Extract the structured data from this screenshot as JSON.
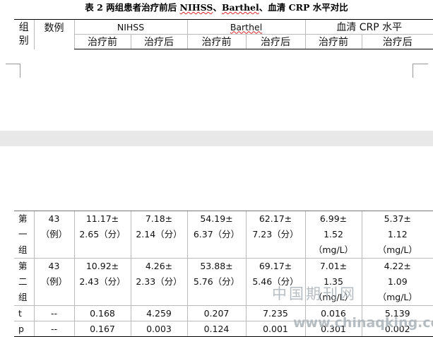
{
  "title": {
    "prefix": "表 2 两组患者治疗前后 ",
    "nihss": "NIHSS",
    "sep1": "、",
    "barthel": "Barthel",
    "suffix": "、血清 CRP 水平对比"
  },
  "header": {
    "group_col": "组\n别",
    "count_col": "数例",
    "nihss": "NIHSS",
    "barthel": "Barthel",
    "crp": "血清 CRP 水平",
    "before": "治疗前",
    "after": "治疗后"
  },
  "rows": [
    {
      "group": "第\n一\n组",
      "count": "43\n（例）",
      "nihss_before": "11.17±\n2.65（分）",
      "nihss_after": "7.18±\n2.14（分）",
      "barthel_before": "54.19±\n6.37（分）",
      "barthel_after": "62.17±\n7.23（分）",
      "crp_before": "6.99±\n1.52\n（mg/L）",
      "crp_after": "5.37±\n1.12\n（mg/L）"
    },
    {
      "group": "第\n二\n组",
      "count": "43\n（例）",
      "nihss_before": "10.92±\n2.43（分）",
      "nihss_after": "4.26±\n2.33（分）",
      "barthel_before": "53.88±\n5.76（分）",
      "barthel_after": "69.17±\n5.46（分）",
      "crp_before": "7.01±\n1.35\n（mg/L）",
      "crp_after": "4.22±\n1.09\n（mg/L）"
    },
    {
      "group": "t",
      "count": "--",
      "nihss_before": "0.168",
      "nihss_after": "4.259",
      "barthel_before": "0.207",
      "barthel_after": "7.235",
      "crp_before": "0.016",
      "crp_after": "5.139"
    },
    {
      "group": "p",
      "count": "--",
      "nihss_before": "0.167",
      "nihss_after": "0.003",
      "barthel_before": "0.124",
      "barthel_after": "0.001",
      "crp_before": "0.301",
      "crp_after": "0.002"
    }
  ],
  "watermark": {
    "text": "中国期刊网",
    "url": "www.chinaqking.com"
  }
}
